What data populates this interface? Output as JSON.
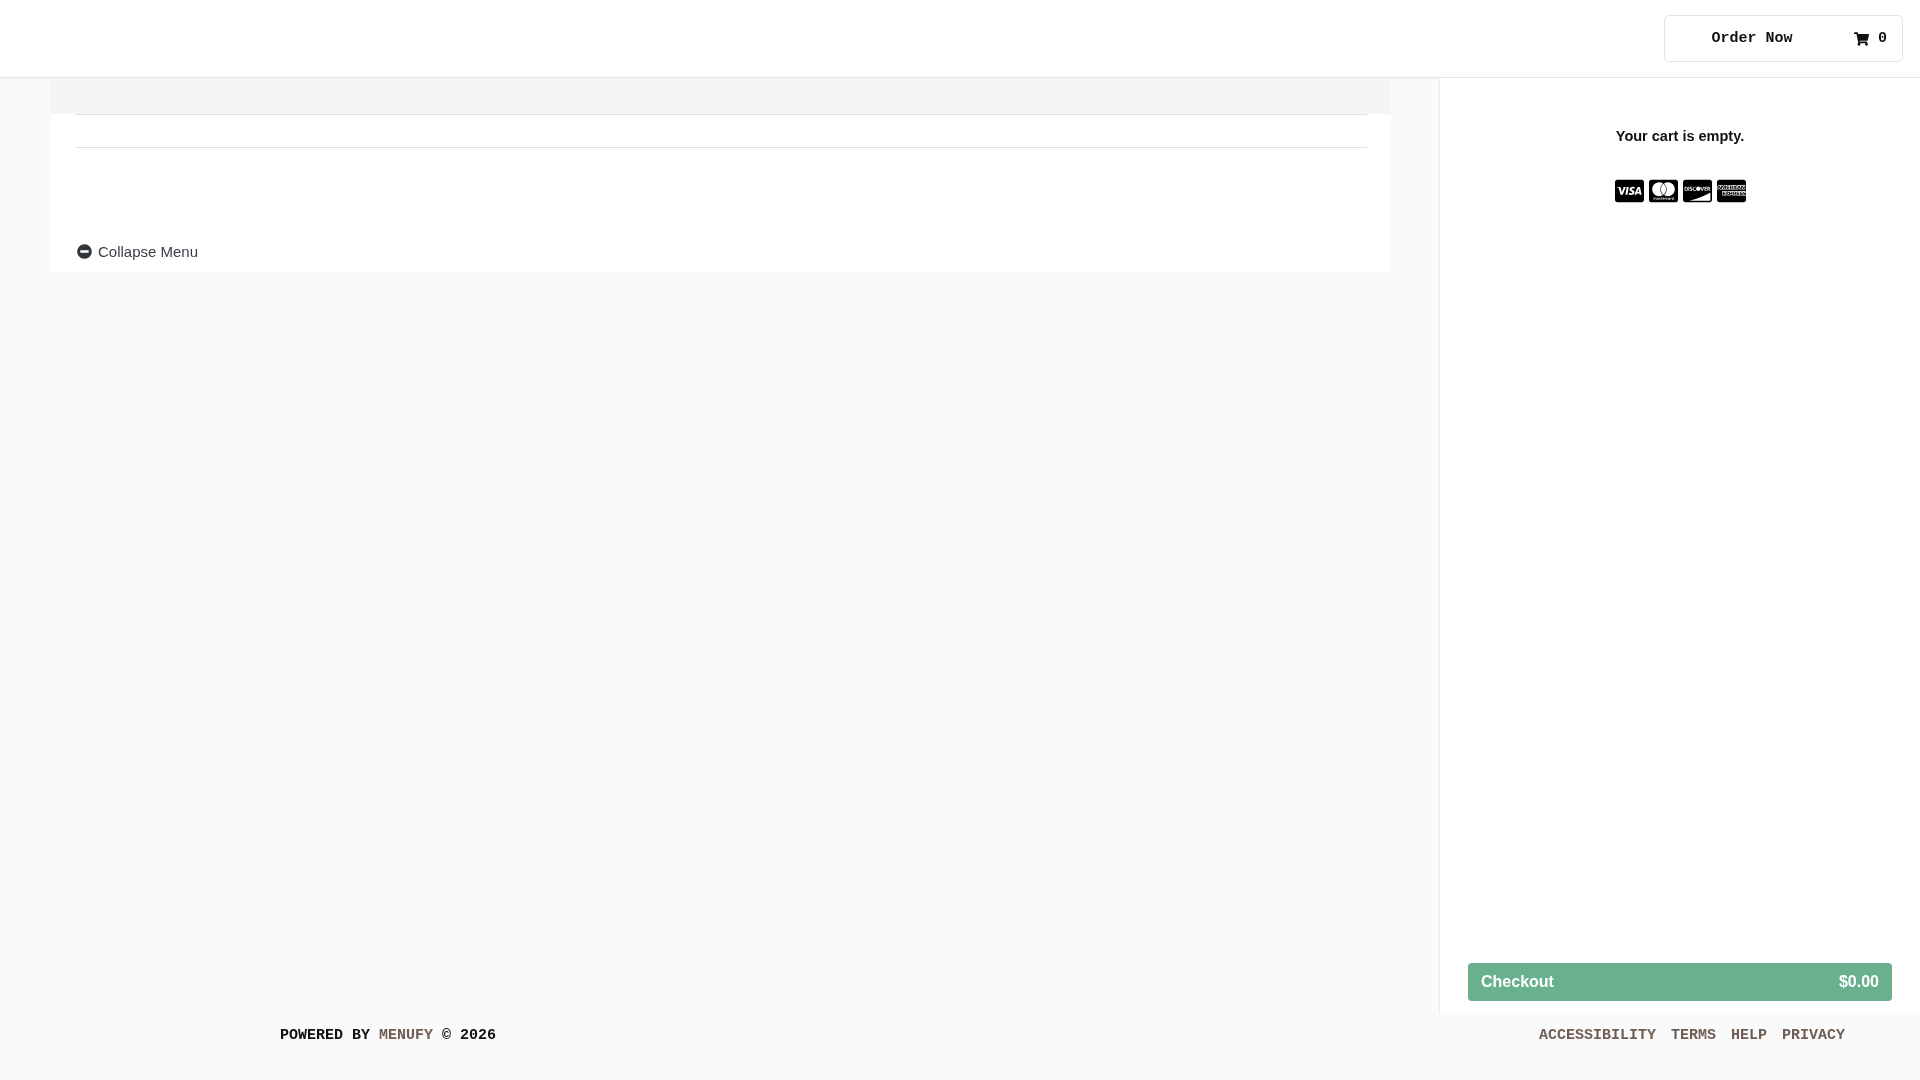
{
  "header": {
    "order_button": "Order Now",
    "cart_count": "0"
  },
  "menu": {
    "collapse_label": "Collapse Menu"
  },
  "cart": {
    "empty_message": "Your cart is empty.",
    "checkout": {
      "label": "Checkout",
      "total": "$0.00"
    }
  },
  "footer": {
    "credit": {
      "prefix": "POWERED BY",
      "brand": "MENUFY",
      "suffix": "© 2026"
    },
    "links": [
      "ACCESSIBILITY",
      "TERMS",
      "HELP",
      "PRIVACY"
    ]
  }
}
